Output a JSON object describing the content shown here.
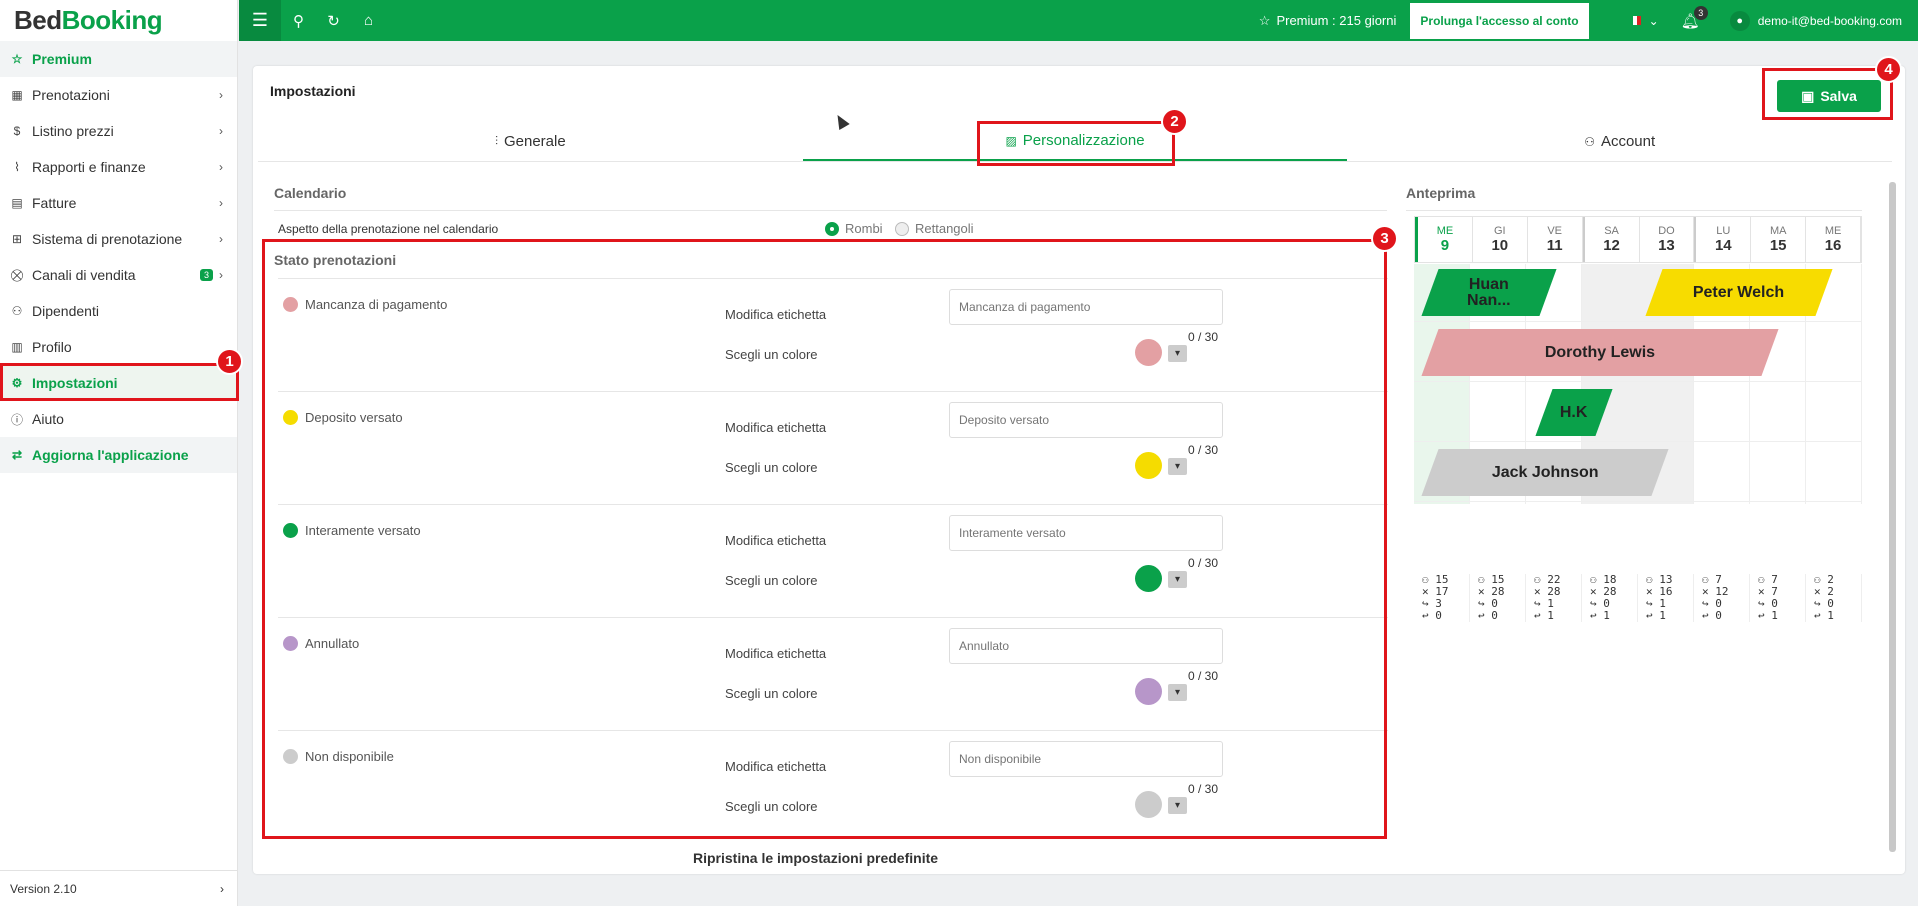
{
  "app": {
    "logo_part1": "Bed",
    "logo_part2": "Booking"
  },
  "sidebar": {
    "items": [
      {
        "label": "Premium",
        "icon": "star-icon"
      },
      {
        "label": "Prenotazioni",
        "icon": "calendar-icon"
      },
      {
        "label": "Listino prezzi",
        "icon": "dollar-icon"
      },
      {
        "label": "Rapporti e finanze",
        "icon": "chart-icon"
      },
      {
        "label": "Fatture",
        "icon": "invoice-icon"
      },
      {
        "label": "Sistema di prenotazione",
        "icon": "grid-icon"
      },
      {
        "label": "Canali di vendita",
        "icon": "cart-icon",
        "badge": "3"
      },
      {
        "label": "Dipendenti",
        "icon": "user-plus-icon"
      },
      {
        "label": "Profilo",
        "icon": "building-icon"
      },
      {
        "label": "Impostazioni",
        "icon": "gear-icon"
      },
      {
        "label": "Aiuto",
        "icon": "info-icon"
      },
      {
        "label": "Aggiorna l'applicazione",
        "icon": "refresh-icon"
      }
    ],
    "version": "Version 2.10"
  },
  "topbar": {
    "premium": "Premium : 215 giorni",
    "extend_button": "Prolunga l'accesso al conto",
    "notifications": "3",
    "user": "demo-it@bed-booking.com"
  },
  "page": {
    "title": "Impostazioni",
    "save": "Salva",
    "tabs": [
      "Generale",
      "Personalizzazione",
      "Account"
    ],
    "calendar_section": "Calendario",
    "aspect_label": "Aspetto della prenotazione nel calendario",
    "radio_options": [
      "Rombi",
      "Rettangoli"
    ],
    "status_section": "Stato prenotazioni",
    "edit_label": "Modifica etichetta",
    "color_label": "Scegli un colore",
    "statuses": [
      {
        "name": "Mancanza di pagamento",
        "placeholder": "Mancanza di pagamento",
        "counter": "0 / 30",
        "color": "#e3a0a3"
      },
      {
        "name": "Deposito versato",
        "placeholder": "Deposito versato",
        "counter": "0 / 30",
        "color": "#f5dc00"
      },
      {
        "name": "Interamente versato",
        "placeholder": "Interamente versato",
        "counter": "0 / 30",
        "color": "#0aa14a"
      },
      {
        "name": "Annullato",
        "placeholder": "Annullato",
        "counter": "0 / 30",
        "color": "#b796c9"
      },
      {
        "name": "Non disponibile",
        "placeholder": "Non disponibile",
        "counter": "0 / 30",
        "color": "#cccccc"
      }
    ],
    "reset": "Ripristina le impostazioni predefinite"
  },
  "preview": {
    "title": "Anteprima",
    "days": [
      {
        "name": "ME",
        "num": "9"
      },
      {
        "name": "GI",
        "num": "10"
      },
      {
        "name": "VE",
        "num": "11"
      },
      {
        "name": "SA",
        "num": "12"
      },
      {
        "name": "DO",
        "num": "13"
      },
      {
        "name": "LU",
        "num": "14"
      },
      {
        "name": "MA",
        "num": "15"
      },
      {
        "name": "ME",
        "num": "16"
      }
    ],
    "bookings": [
      "Huan Nan...",
      "Peter Welch",
      "Dorothy Lewis",
      "H.K",
      "Jack Johnson"
    ],
    "stats": [
      [
        "15",
        "17",
        "3",
        "0"
      ],
      [
        "15",
        "28",
        "0",
        "0"
      ],
      [
        "22",
        "28",
        "1",
        "1"
      ],
      [
        "18",
        "28",
        "0",
        "1"
      ],
      [
        "13",
        "16",
        "1",
        "1"
      ],
      [
        "7",
        "12",
        "0",
        "0"
      ],
      [
        "7",
        "7",
        "0",
        "1"
      ],
      [
        "2",
        "2",
        "0",
        "1"
      ]
    ]
  },
  "annotations": [
    "1",
    "2",
    "3",
    "4"
  ]
}
